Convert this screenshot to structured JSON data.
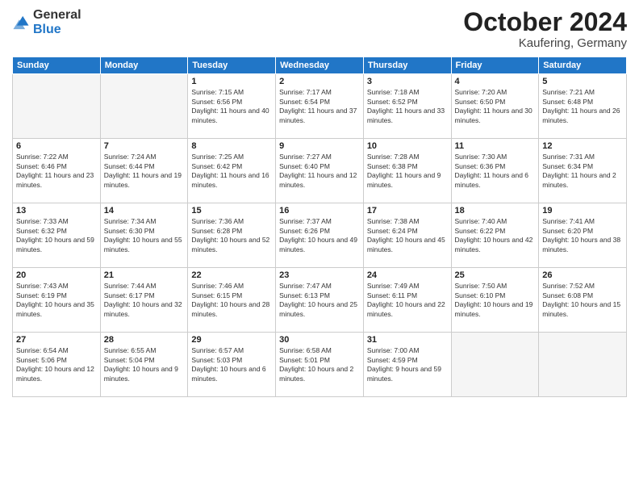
{
  "logo": {
    "general": "General",
    "blue": "Blue"
  },
  "title": "October 2024",
  "location": "Kaufering, Germany",
  "weekdays": [
    "Sunday",
    "Monday",
    "Tuesday",
    "Wednesday",
    "Thursday",
    "Friday",
    "Saturday"
  ],
  "weeks": [
    [
      {
        "day": "",
        "info": ""
      },
      {
        "day": "",
        "info": ""
      },
      {
        "day": "1",
        "info": "Sunrise: 7:15 AM\nSunset: 6:56 PM\nDaylight: 11 hours and 40 minutes."
      },
      {
        "day": "2",
        "info": "Sunrise: 7:17 AM\nSunset: 6:54 PM\nDaylight: 11 hours and 37 minutes."
      },
      {
        "day": "3",
        "info": "Sunrise: 7:18 AM\nSunset: 6:52 PM\nDaylight: 11 hours and 33 minutes."
      },
      {
        "day": "4",
        "info": "Sunrise: 7:20 AM\nSunset: 6:50 PM\nDaylight: 11 hours and 30 minutes."
      },
      {
        "day": "5",
        "info": "Sunrise: 7:21 AM\nSunset: 6:48 PM\nDaylight: 11 hours and 26 minutes."
      }
    ],
    [
      {
        "day": "6",
        "info": "Sunrise: 7:22 AM\nSunset: 6:46 PM\nDaylight: 11 hours and 23 minutes."
      },
      {
        "day": "7",
        "info": "Sunrise: 7:24 AM\nSunset: 6:44 PM\nDaylight: 11 hours and 19 minutes."
      },
      {
        "day": "8",
        "info": "Sunrise: 7:25 AM\nSunset: 6:42 PM\nDaylight: 11 hours and 16 minutes."
      },
      {
        "day": "9",
        "info": "Sunrise: 7:27 AM\nSunset: 6:40 PM\nDaylight: 11 hours and 12 minutes."
      },
      {
        "day": "10",
        "info": "Sunrise: 7:28 AM\nSunset: 6:38 PM\nDaylight: 11 hours and 9 minutes."
      },
      {
        "day": "11",
        "info": "Sunrise: 7:30 AM\nSunset: 6:36 PM\nDaylight: 11 hours and 6 minutes."
      },
      {
        "day": "12",
        "info": "Sunrise: 7:31 AM\nSunset: 6:34 PM\nDaylight: 11 hours and 2 minutes."
      }
    ],
    [
      {
        "day": "13",
        "info": "Sunrise: 7:33 AM\nSunset: 6:32 PM\nDaylight: 10 hours and 59 minutes."
      },
      {
        "day": "14",
        "info": "Sunrise: 7:34 AM\nSunset: 6:30 PM\nDaylight: 10 hours and 55 minutes."
      },
      {
        "day": "15",
        "info": "Sunrise: 7:36 AM\nSunset: 6:28 PM\nDaylight: 10 hours and 52 minutes."
      },
      {
        "day": "16",
        "info": "Sunrise: 7:37 AM\nSunset: 6:26 PM\nDaylight: 10 hours and 49 minutes."
      },
      {
        "day": "17",
        "info": "Sunrise: 7:38 AM\nSunset: 6:24 PM\nDaylight: 10 hours and 45 minutes."
      },
      {
        "day": "18",
        "info": "Sunrise: 7:40 AM\nSunset: 6:22 PM\nDaylight: 10 hours and 42 minutes."
      },
      {
        "day": "19",
        "info": "Sunrise: 7:41 AM\nSunset: 6:20 PM\nDaylight: 10 hours and 38 minutes."
      }
    ],
    [
      {
        "day": "20",
        "info": "Sunrise: 7:43 AM\nSunset: 6:19 PM\nDaylight: 10 hours and 35 minutes."
      },
      {
        "day": "21",
        "info": "Sunrise: 7:44 AM\nSunset: 6:17 PM\nDaylight: 10 hours and 32 minutes."
      },
      {
        "day": "22",
        "info": "Sunrise: 7:46 AM\nSunset: 6:15 PM\nDaylight: 10 hours and 28 minutes."
      },
      {
        "day": "23",
        "info": "Sunrise: 7:47 AM\nSunset: 6:13 PM\nDaylight: 10 hours and 25 minutes."
      },
      {
        "day": "24",
        "info": "Sunrise: 7:49 AM\nSunset: 6:11 PM\nDaylight: 10 hours and 22 minutes."
      },
      {
        "day": "25",
        "info": "Sunrise: 7:50 AM\nSunset: 6:10 PM\nDaylight: 10 hours and 19 minutes."
      },
      {
        "day": "26",
        "info": "Sunrise: 7:52 AM\nSunset: 6:08 PM\nDaylight: 10 hours and 15 minutes."
      }
    ],
    [
      {
        "day": "27",
        "info": "Sunrise: 6:54 AM\nSunset: 5:06 PM\nDaylight: 10 hours and 12 minutes."
      },
      {
        "day": "28",
        "info": "Sunrise: 6:55 AM\nSunset: 5:04 PM\nDaylight: 10 hours and 9 minutes."
      },
      {
        "day": "29",
        "info": "Sunrise: 6:57 AM\nSunset: 5:03 PM\nDaylight: 10 hours and 6 minutes."
      },
      {
        "day": "30",
        "info": "Sunrise: 6:58 AM\nSunset: 5:01 PM\nDaylight: 10 hours and 2 minutes."
      },
      {
        "day": "31",
        "info": "Sunrise: 7:00 AM\nSunset: 4:59 PM\nDaylight: 9 hours and 59 minutes."
      },
      {
        "day": "",
        "info": ""
      },
      {
        "day": "",
        "info": ""
      }
    ]
  ]
}
